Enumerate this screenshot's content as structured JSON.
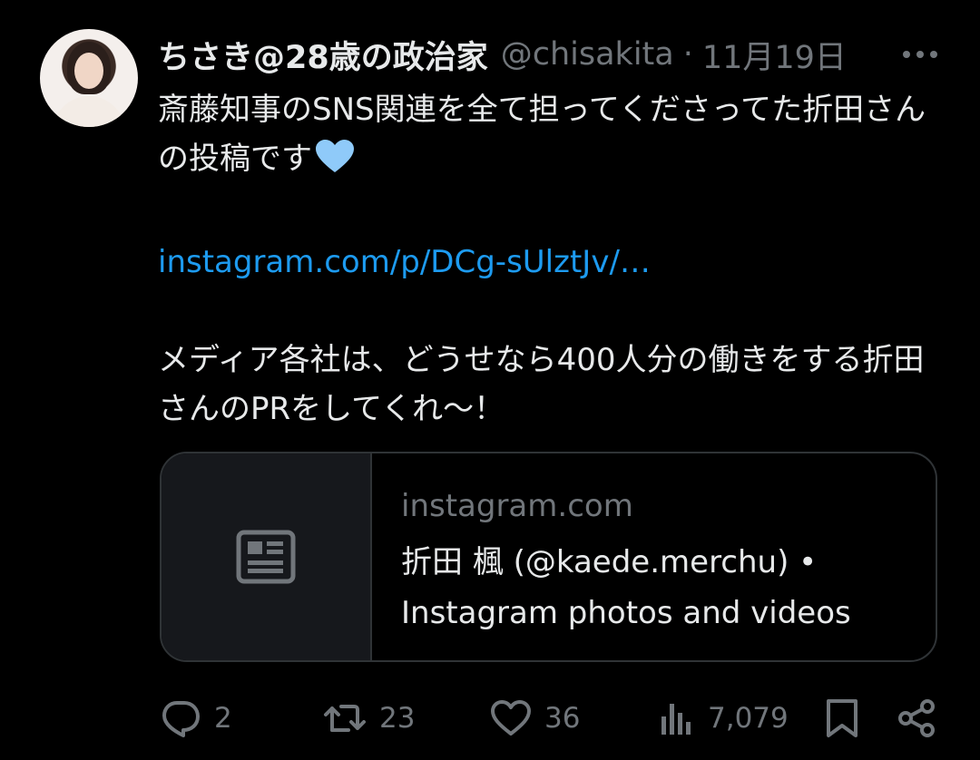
{
  "author": {
    "display_name": "ちさき@28歳の政治家",
    "handle": "@chisakita",
    "separator": "·",
    "date": "11月19日"
  },
  "tweet": {
    "line1": "斎藤知事のSNS関連を全て担ってくださってた折田さんの投稿です",
    "link": "instagram.com/p/DCg-sUlztJv/…",
    "line2": "メディア各社は、どうせなら400人分の働きをする折田さんのPRをしてくれ〜！"
  },
  "card": {
    "domain": "instagram.com",
    "title": "折田 楓 (@kaede.merchu) • Instagram photos and videos",
    "thumb_icon": "article-icon"
  },
  "actions": {
    "replies": "2",
    "reposts": "23",
    "likes": "36",
    "views": "7,079"
  },
  "colors": {
    "background": "#000000",
    "text": "#e7e9ea",
    "muted": "#71767b",
    "link": "#1d9bf0",
    "border": "#2f3336",
    "heart": "#8fcaf9"
  },
  "icons": {
    "more": "more-horizontal-icon",
    "reply": "reply-icon",
    "repost": "repost-icon",
    "like": "heart-icon",
    "views": "views-icon",
    "bookmark": "bookmark-icon",
    "share": "share-icon"
  }
}
